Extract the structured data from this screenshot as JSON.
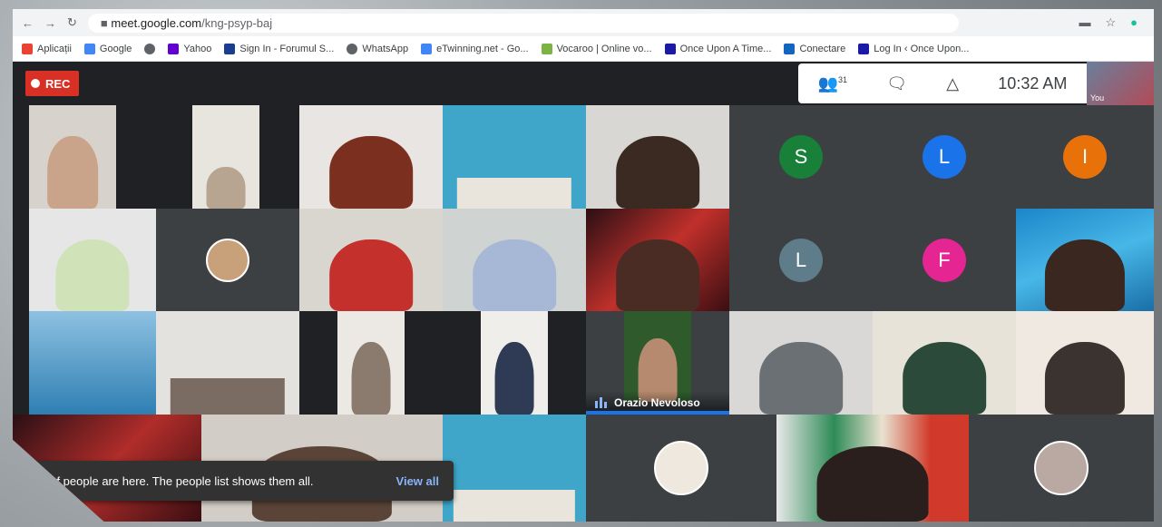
{
  "browser": {
    "url_host": "meet.google.com",
    "url_path": "/kng-psyp-baj"
  },
  "bookmarks": [
    {
      "label": "Aplicații",
      "color": "#4285f4"
    },
    {
      "label": "Google",
      "color": "#4285f4"
    },
    {
      "label": "",
      "color": "#5f6368"
    },
    {
      "label": "Yahoo",
      "color": "#6001d2"
    },
    {
      "label": "Sign In - Forumul S...",
      "color": "#1a3d8f"
    },
    {
      "label": "WhatsApp",
      "color": "#5f6368"
    },
    {
      "label": "eTwinning.net - Go...",
      "color": "#4285f4"
    },
    {
      "label": "Vocaroo | Online vo...",
      "color": "#7cb342"
    },
    {
      "label": "Once Upon A Time...",
      "color": "#1a1aa6"
    },
    {
      "label": "Conectare",
      "color": "#1565c0"
    },
    {
      "label": "Log In ‹ Once Upon...",
      "color": "#1a1aa6"
    }
  ],
  "meet": {
    "rec_label": "REC",
    "participant_count": "31",
    "time": "10:32 AM",
    "self_label": "You",
    "speaker_name": "Orazio Nevoloso",
    "initials": {
      "s": {
        "letter": "S",
        "color": "#188038"
      },
      "l1": {
        "letter": "L",
        "color": "#1a73e8"
      },
      "i": {
        "letter": "I",
        "color": "#e8710a"
      },
      "l2": {
        "letter": "L",
        "color": "#5f7c8a"
      },
      "f": {
        "letter": "F",
        "color": "#e52592"
      }
    },
    "toast_text": "t of people are here. The people list shows them all.",
    "toast_action": "View all"
  }
}
